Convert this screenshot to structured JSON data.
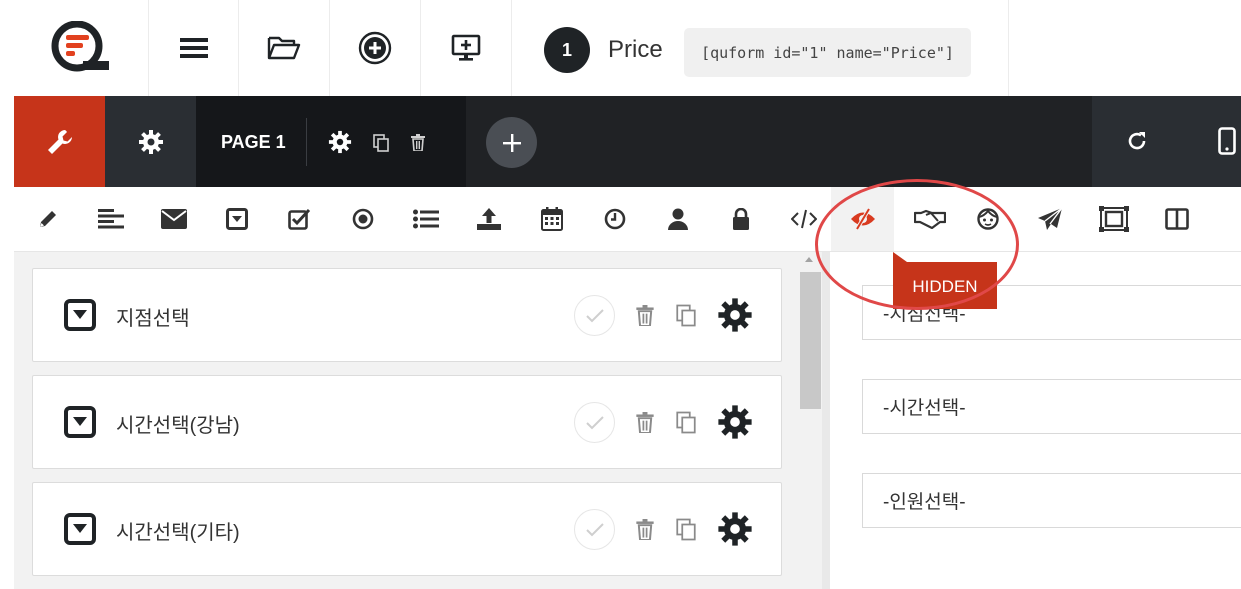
{
  "top_bar": {
    "logo": "quform-logo",
    "menu_icon": "hamburger-menu-icon",
    "open_icon": "folder-open-icon",
    "add_icon": "plus-circle-icon",
    "preview_icon": "monitor-plus-icon",
    "form_id": "1",
    "form_name": "Price",
    "shortcode": "[quform id=\"1\" name=\"Price\"]"
  },
  "dark_bar": {
    "wrench_icon": "wrench-icon",
    "settings_icon": "gear-icon",
    "page_label": "PAGE 1",
    "page_settings_icon": "gear-icon",
    "page_duplicate_icon": "copy-icon",
    "page_delete_icon": "trash-icon",
    "add_page_icon": "plus-icon",
    "refresh_icon": "refresh-icon",
    "mobile_icon": "mobile-icon"
  },
  "element_toolbar": {
    "tools": [
      "pencil-icon",
      "align-left-icon",
      "envelope-icon",
      "select-dropdown-icon",
      "checkbox-icon",
      "radio-icon",
      "list-icon",
      "upload-icon",
      "calendar-icon",
      "clock-icon",
      "user-icon",
      "lock-icon",
      "code-icon",
      "eye-slash-icon",
      "handshake-icon",
      "face-icon",
      "paper-plane-icon",
      "group-icon",
      "columns-icon"
    ],
    "tooltip": "HIDDEN"
  },
  "fields": [
    {
      "label": "지점선택"
    },
    {
      "label": "시간선택(강남)"
    },
    {
      "label": "시간선택(기타)"
    }
  ],
  "preview": {
    "selects": [
      "-지점선택-",
      "-시간선택-",
      "-인원선택-"
    ]
  },
  "colors": {
    "accent": "#c6341a",
    "dark": "#202225",
    "highlight_ring": "#e04848"
  }
}
